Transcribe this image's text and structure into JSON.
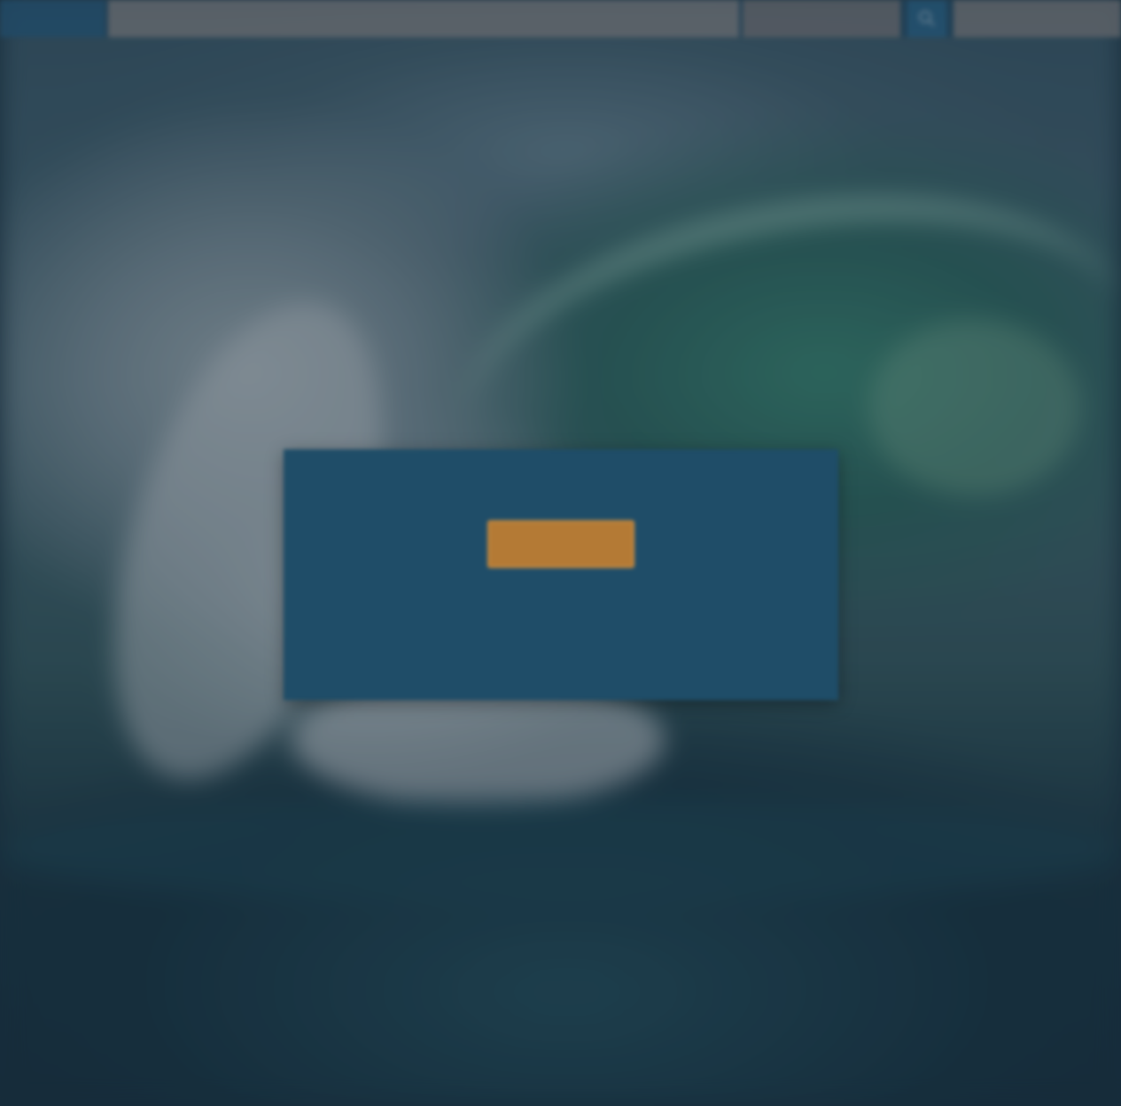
{
  "topbar": {
    "logo_text": "",
    "search_placeholder": "",
    "search_scope": "",
    "account_label": ""
  },
  "modal": {
    "title": "",
    "message": "",
    "button_label": ""
  },
  "colors": {
    "modal_background": "#1f4d68",
    "button_accent": "#b47a35",
    "topbar_background": "#2a5570"
  },
  "icons": {
    "search_button_icon": "search-icon"
  }
}
